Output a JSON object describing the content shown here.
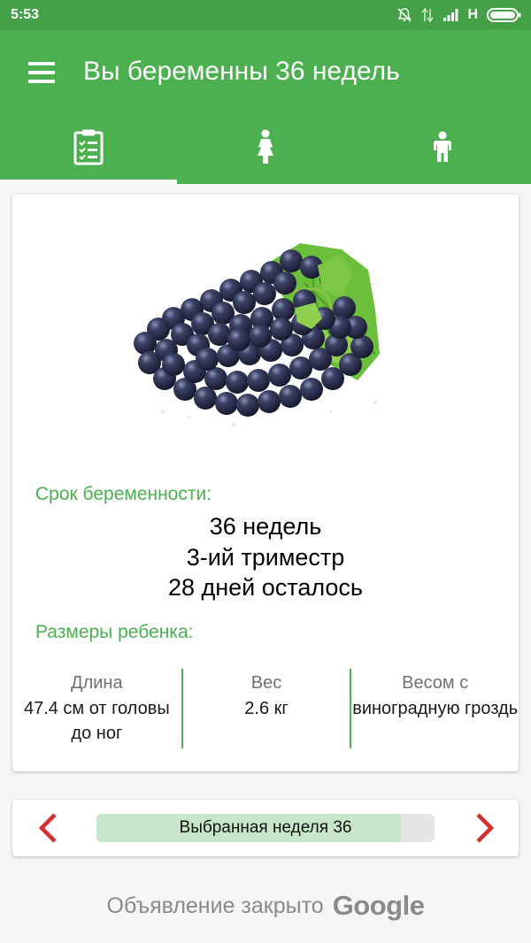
{
  "status_bar": {
    "time": "5:53",
    "network": "H",
    "icons": [
      "notifications-off-icon",
      "data-transfer-icon",
      "signal-icon",
      "battery-icon"
    ]
  },
  "app_bar": {
    "title": "Вы беременны 36 недель",
    "menu_icon": "hamburger-menu-icon",
    "background": "#4caf50"
  },
  "tabs": [
    {
      "icon": "clipboard-checklist-icon",
      "selected": true
    },
    {
      "icon": "pregnant-woman-icon",
      "selected": false
    },
    {
      "icon": "child-icon",
      "selected": false
    }
  ],
  "card": {
    "image": "grapes-bunch",
    "term_label": "Срок беременности:",
    "weeks": "36 недель",
    "trimester": "3-ий триместр",
    "days_left": "28 дней осталось",
    "size_label": "Размеры ребенка:",
    "metrics": [
      {
        "label": "Длина",
        "value": "47.4 см от головы до ног"
      },
      {
        "label": "Вес",
        "value": "2.6 кг"
      },
      {
        "label": "Весом с",
        "value": "виноградную гроздь"
      }
    ]
  },
  "week_selector": {
    "prev_icon": "chevron-left-icon",
    "next_icon": "chevron-right-icon",
    "label": "Выбранная неделя 36",
    "progress": 0.9
  },
  "ad": {
    "text": "Объявление закрыто",
    "brand": "Google"
  },
  "colors": {
    "accent": "#4caf50",
    "status_bar": "#43a047",
    "arrow": "#d32f2f",
    "progress_fill": "#c8e6c9"
  }
}
